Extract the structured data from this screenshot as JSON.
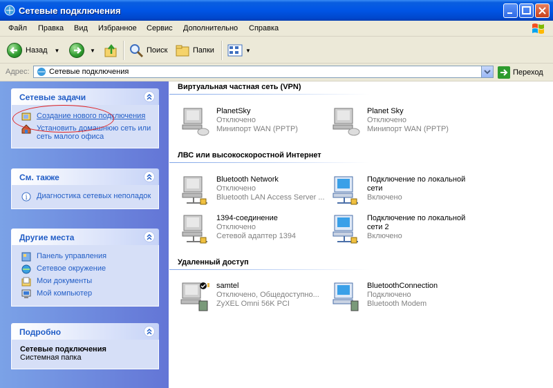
{
  "window": {
    "title": "Сетевые подключения"
  },
  "menu": [
    "Файл",
    "Правка",
    "Вид",
    "Избранное",
    "Сервис",
    "Дополнительно",
    "Справка"
  ],
  "toolbar": {
    "back": "Назад",
    "search": "Поиск",
    "folders": "Папки"
  },
  "address": {
    "label": "Адрес:",
    "value": "Сетевые подключения",
    "go": "Переход"
  },
  "sidebar": {
    "network_tasks": {
      "title": "Сетевые задачи",
      "items": [
        "Создание нового подключения",
        "Установить домашнюю сеть или сеть малого офиса"
      ]
    },
    "see_also": {
      "title": "См. также",
      "items": [
        "Диагностика сетевых неполадок"
      ]
    },
    "other_places": {
      "title": "Другие места",
      "items": [
        "Панель управления",
        "Сетевое окружение",
        "Мои документы",
        "Мой компьютер"
      ]
    },
    "details": {
      "title": "Подробно",
      "name": "Сетевые подключения",
      "type": "Системная папка"
    }
  },
  "groups": [
    {
      "title": "Виртуальная частная сеть (VPN)",
      "items": [
        {
          "name": "PlanetSky",
          "status": "Отключено",
          "device": "Минипорт WAN (PPTP)"
        },
        {
          "name": "Planet Sky",
          "status": "Отключено",
          "device": "Минипорт WAN (PPTP)"
        }
      ]
    },
    {
      "title": "ЛВС или высокоскоростной Интернет",
      "items": [
        {
          "name": "Bluetooth Network",
          "status": "Отключено",
          "device": "Bluetooth LAN Access Server ..."
        },
        {
          "name": "Подключение по локальной сети",
          "status": "Включено"
        },
        {
          "name": "1394-соединение",
          "status": "Отключено",
          "device": "Сетевой адаптер 1394"
        },
        {
          "name": "Подключение по локальной сети 2",
          "status": "Включено"
        }
      ]
    },
    {
      "title": "Удаленный доступ",
      "items": [
        {
          "name": "samtel",
          "status": "Отключено, Общедоступно...",
          "device": "ZyXEL Omni 56K PCI"
        },
        {
          "name": "BluetoothConnection",
          "status": "Подключено",
          "device": "Bluetooth Modem"
        }
      ]
    }
  ]
}
